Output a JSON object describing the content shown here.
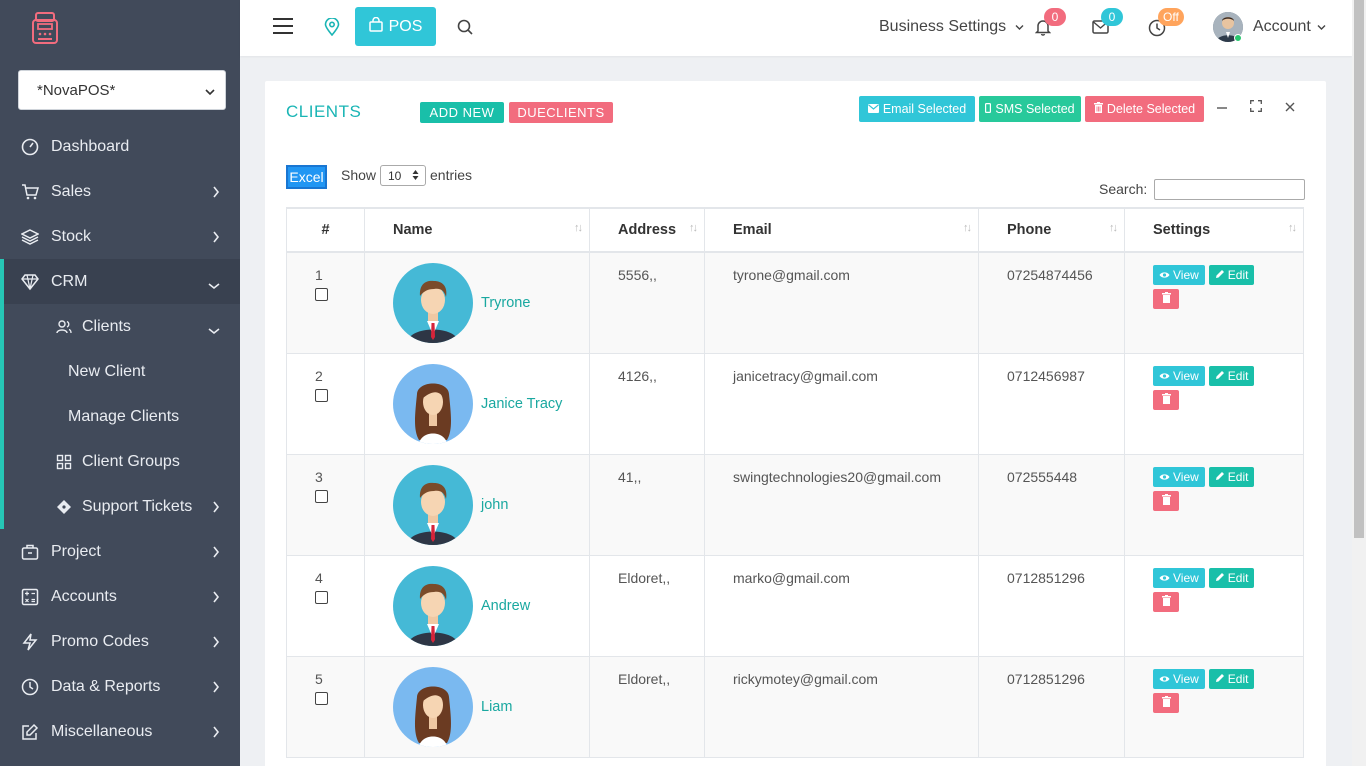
{
  "app": {
    "branch": "*NovaPOS*"
  },
  "sidebar": {
    "items": [
      {
        "label": "Dashboard",
        "icon": "dashboard-gauge-icon"
      },
      {
        "label": "Sales",
        "icon": "cart-icon"
      },
      {
        "label": "Stock",
        "icon": "layers-icon"
      },
      {
        "label": "CRM",
        "icon": "diamond-icon"
      },
      {
        "label": "Project",
        "icon": "briefcase-icon"
      },
      {
        "label": "Accounts",
        "icon": "calculator-icon"
      },
      {
        "label": "Promo Codes",
        "icon": "bolt-icon"
      },
      {
        "label": "Data & Reports",
        "icon": "clock-icon"
      },
      {
        "label": "Miscellaneous",
        "icon": "edit-icon"
      }
    ],
    "crm_sub": [
      {
        "label": "Clients",
        "icon": "users-icon"
      },
      {
        "label": "New Client"
      },
      {
        "label": "Manage Clients"
      },
      {
        "label": "Client Groups",
        "icon": "grid-icon"
      },
      {
        "label": "Support Tickets",
        "icon": "ticket-icon"
      }
    ]
  },
  "topbar": {
    "pos_label": "POS",
    "business_settings": "Business Settings",
    "notifications_count": "0",
    "messages_count": "0",
    "clock_status": "Off",
    "account_label": "Account",
    "badge_colors": {
      "notifications": "#f26c7e",
      "messages": "#30c6d8",
      "clock": "#ffa45c"
    }
  },
  "card": {
    "title": "CLIENTS",
    "add_new": "ADD NEW",
    "due_clients": "DUECLIENTS",
    "email_selected": "Email Selected",
    "sms_selected": "SMS Selected",
    "delete_selected": "Delete Selected",
    "excel": "Excel",
    "show": "Show",
    "entries_value": "10",
    "entries": "entries",
    "search": "Search:"
  },
  "table": {
    "headers": [
      "#",
      "Name",
      "Address",
      "Email",
      "Phone",
      "Settings"
    ],
    "view_label": "View",
    "edit_label": "Edit",
    "rows": [
      {
        "num": "1",
        "name": "Tryrone",
        "avatar": "male",
        "address": "5556,,",
        "email": "tyrone@gmail.com",
        "phone": "07254874456"
      },
      {
        "num": "2",
        "name": "Janice Tracy",
        "avatar": "female",
        "address": "4126,,",
        "email": "janicetracy@gmail.com",
        "phone": "0712456987"
      },
      {
        "num": "3",
        "name": "john",
        "avatar": "male",
        "address": "41,,",
        "email": "swingtechnologies20@gmail.com",
        "phone": "072555448"
      },
      {
        "num": "4",
        "name": "Andrew",
        "avatar": "male",
        "address": "Eldoret,,",
        "email": "marko@gmail.com",
        "phone": "0712851296"
      },
      {
        "num": "5",
        "name": "Liam",
        "avatar": "female",
        "address": "Eldoret,,",
        "email": "rickymotey@gmail.com",
        "phone": "0712851296"
      }
    ]
  }
}
